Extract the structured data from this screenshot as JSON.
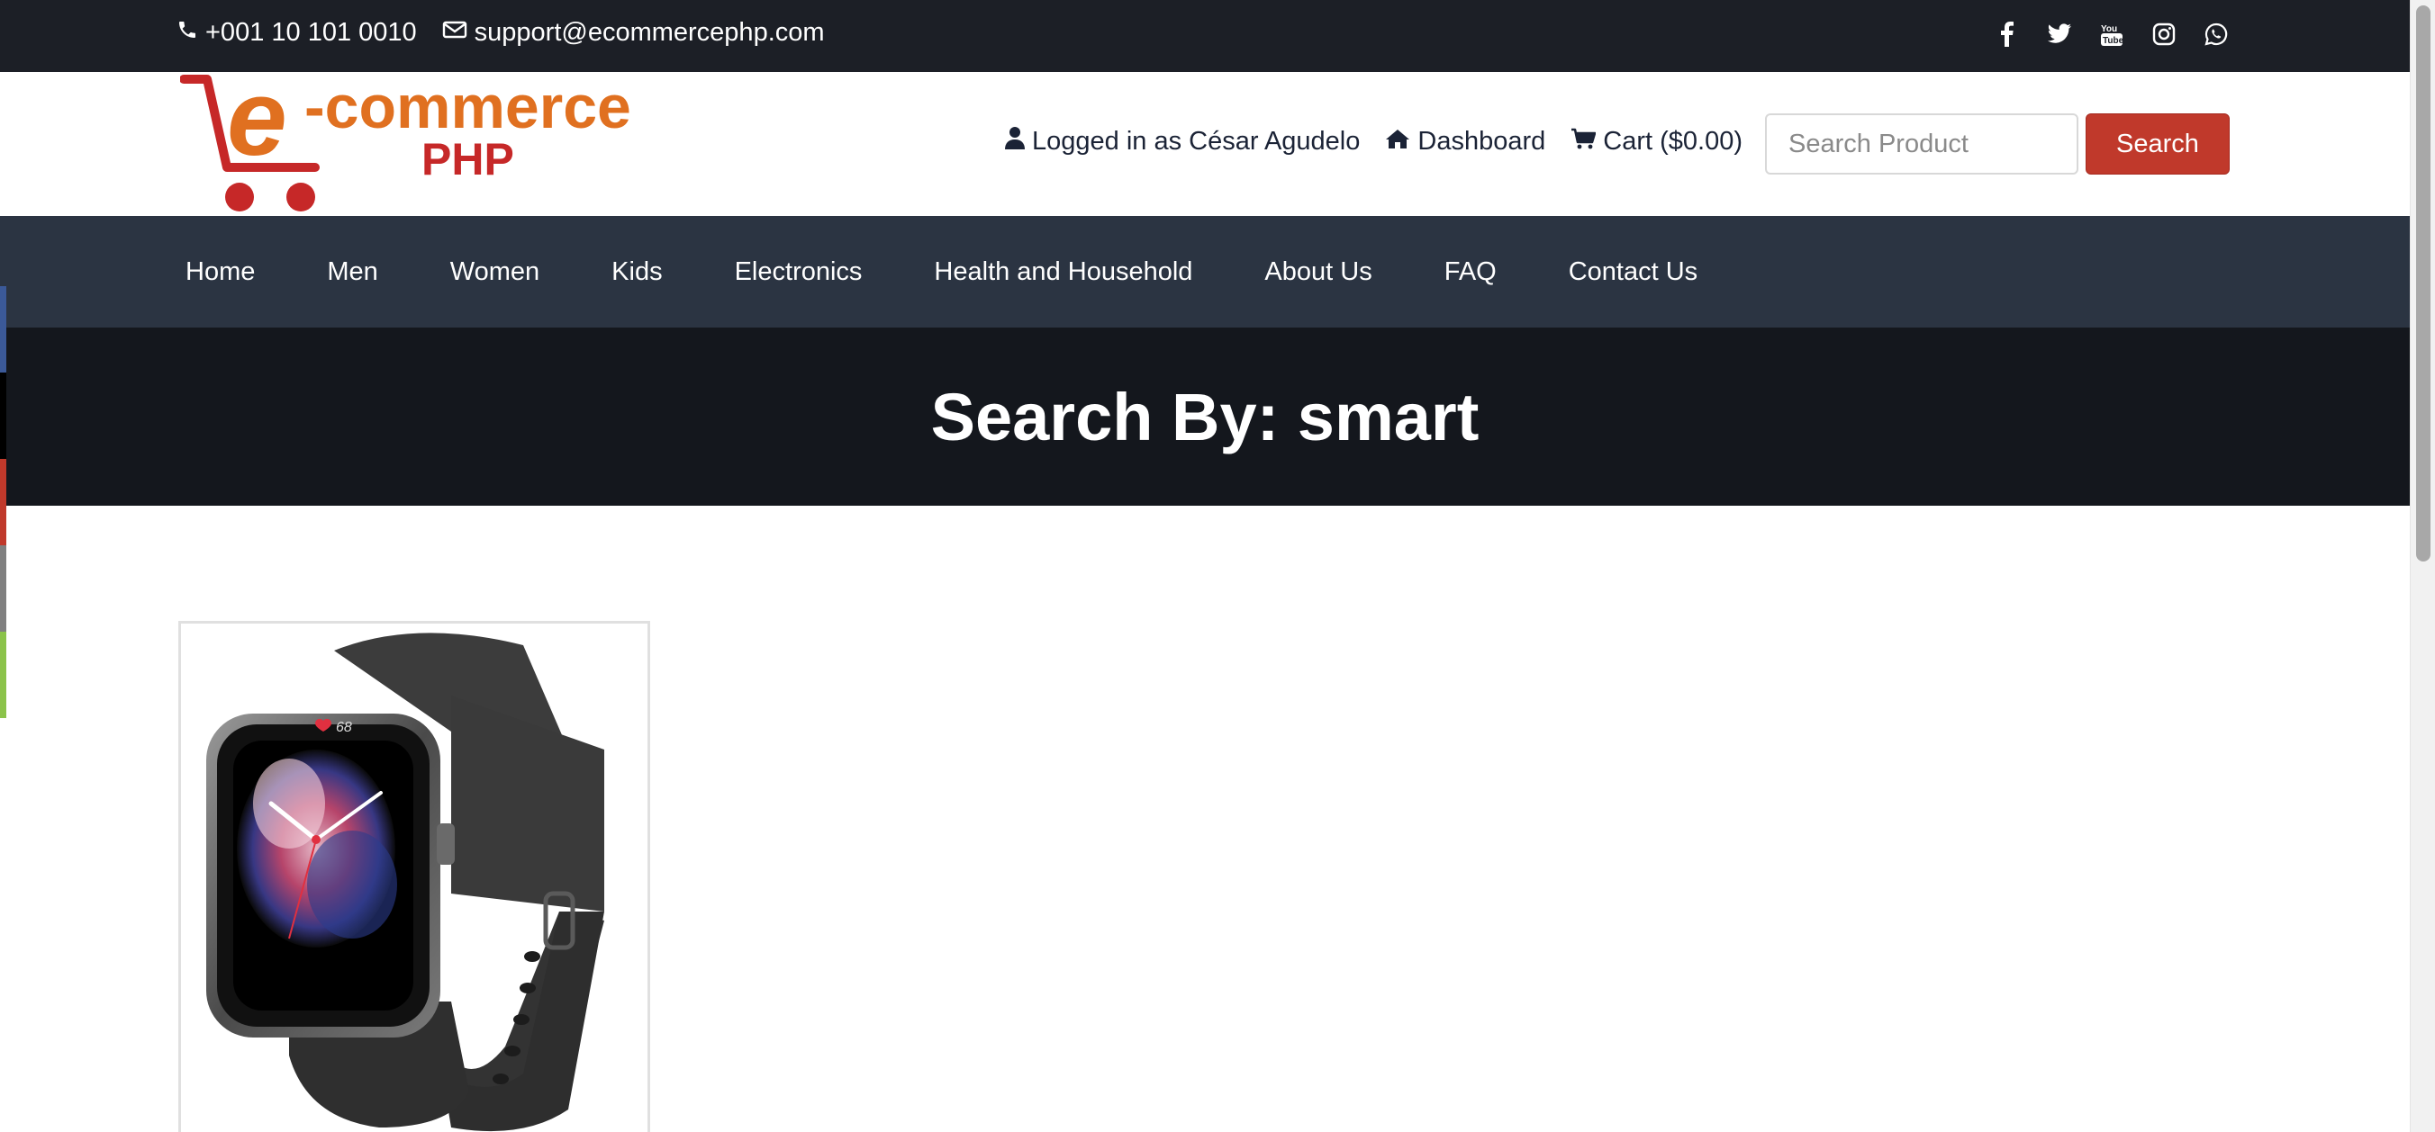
{
  "topbar": {
    "phone": "+001 10 101 0010",
    "email": "support@ecommercephp.com",
    "social_icons": [
      "facebook-icon",
      "twitter-icon",
      "youtube-icon",
      "instagram-icon",
      "whatsapp-icon"
    ]
  },
  "header": {
    "logo_text": "e-commerce",
    "logo_subtext": "PHP",
    "user_label": "Logged in as César Agudelo",
    "dashboard_label": "Dashboard",
    "cart_label": "Cart ($0.00)",
    "search_placeholder": "Search Product",
    "search_button": "Search"
  },
  "nav": {
    "items": [
      "Home",
      "Men",
      "Women",
      "Kids",
      "Electronics",
      "Health and Household",
      "About Us",
      "FAQ",
      "Contact Us"
    ]
  },
  "banner": {
    "title": "Search By: smart"
  },
  "results": {
    "products": [
      {
        "image": "smartwatch",
        "watch_face_reading": "68"
      }
    ]
  },
  "colors": {
    "topbar": "#1c1f26",
    "nav": "#2b3442",
    "banner": "#14171d",
    "accent": "#c0392b",
    "share_strip": [
      "#3b5998",
      "#000000",
      "#c0392b",
      "#808080",
      "#8bc34a"
    ]
  }
}
